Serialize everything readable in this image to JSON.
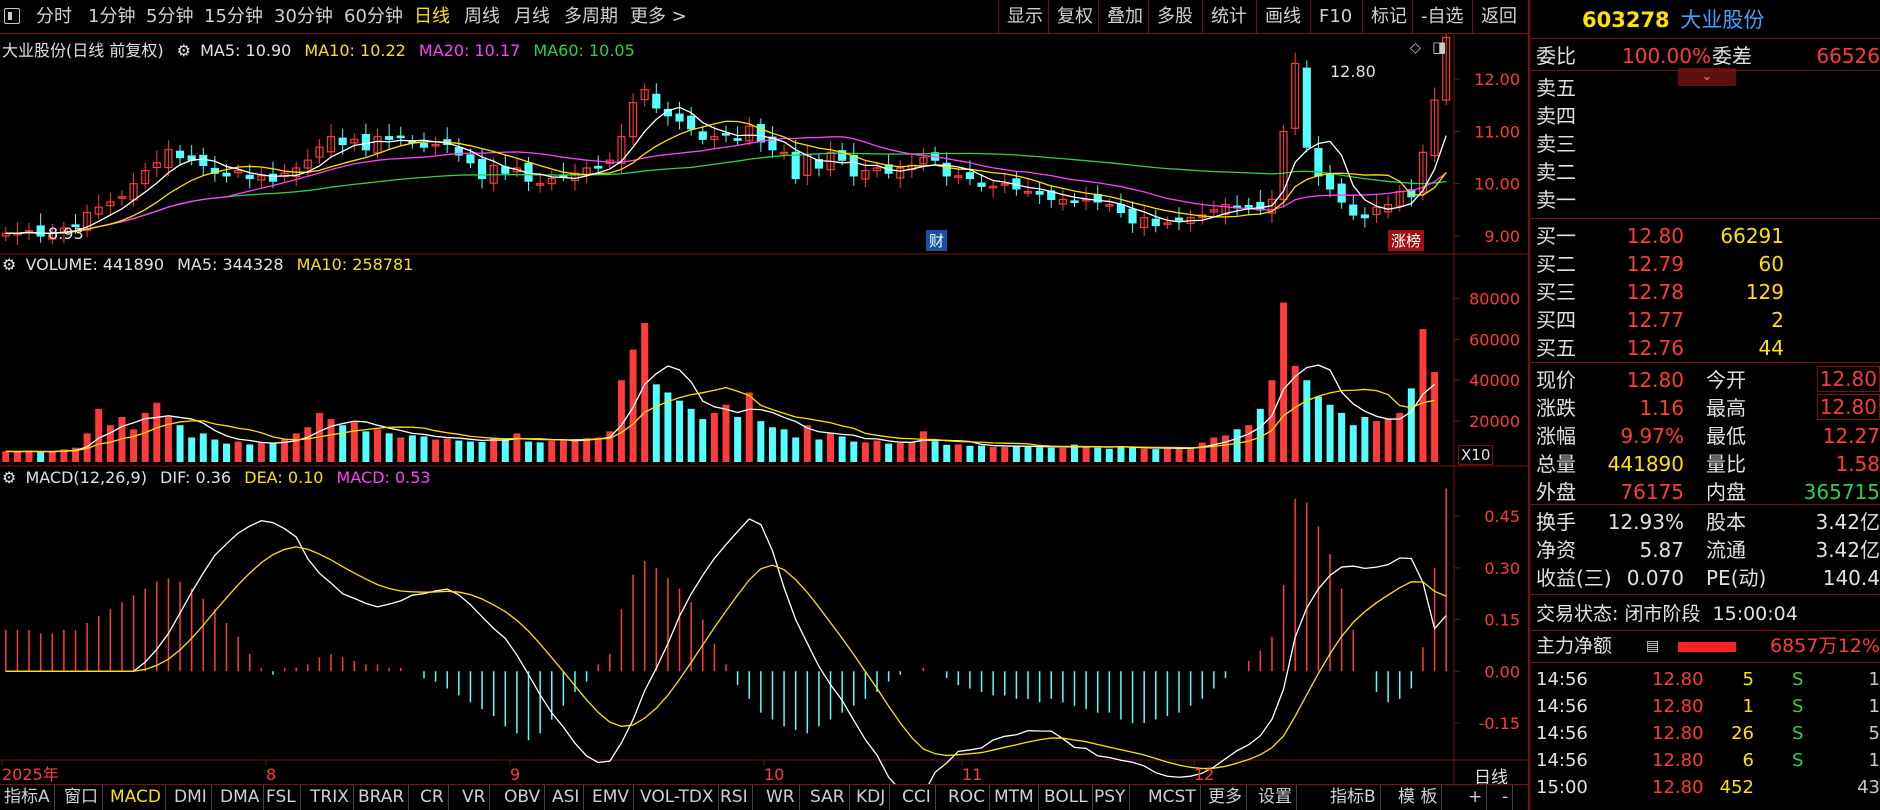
{
  "toolbar": {
    "left_tabs": [
      "分时",
      "1分钟",
      "5分钟",
      "15分钟",
      "30分钟",
      "60分钟",
      "日线",
      "周线",
      "月线",
      "多周期",
      "更多 >"
    ],
    "active_tab": "日线",
    "right_buttons": [
      "显示",
      "复权",
      "叠加",
      "多股",
      "统计",
      "画线",
      "F10",
      "标记",
      "-自选",
      "返回"
    ]
  },
  "main_chart": {
    "title": "大业股份(日线 前复权)",
    "ma5": "MA5: 10.90",
    "ma10": "MA10: 10.22",
    "ma20": "MA20: 10.17",
    "ma60": "MA60: 10.05",
    "high_label": "12.80",
    "low_label": "8.93",
    "badge_cai": "财",
    "badge_zhangbang": "涨榜",
    "yticks": [
      "12.00",
      "11.00",
      "10.00",
      "9.00"
    ]
  },
  "volume_chart": {
    "title": "VOLUME: 441890",
    "ma5": "MA5: 344328",
    "ma10": "MA10: 258781",
    "unit": "X10",
    "yticks": [
      "80000",
      "60000",
      "40000",
      "20000"
    ]
  },
  "macd_chart": {
    "title": "MACD(12,26,9)",
    "dif": "DIF: 0.36",
    "dea": "DEA: 0.10",
    "macd": "MACD: 0.53",
    "yticks": [
      "0.45",
      "0.30",
      "0.15",
      "0.00",
      "-0.15"
    ]
  },
  "xaxis": {
    "labels": [
      "2025年",
      "8",
      "9",
      "10",
      "11",
      "12"
    ],
    "period": "日线"
  },
  "bottom_tabs": [
    "指标A",
    "窗口",
    "MACD",
    "DMI",
    "DMA",
    "FSL",
    "TRIX",
    "BRAR",
    "CR",
    "VR",
    "OBV",
    "ASI",
    "EMV",
    "VOL-TDX",
    "RSI",
    "WR",
    "SAR",
    "KDJ",
    "CCI",
    "ROC",
    "MTM",
    "BOLL",
    "PSY",
    "MCST",
    "更多",
    "设置",
    "指标B",
    "模 板",
    "+",
    "-"
  ],
  "active_bottom_tab": "MACD",
  "stock": {
    "code": "603278",
    "name": "大业股份",
    "weibi_label": "委比",
    "weibi": "100.00%",
    "weicha_label": "委差",
    "weicha": "66526",
    "sell_labels": [
      "卖五",
      "卖四",
      "卖三",
      "卖二",
      "卖一"
    ],
    "buy": [
      {
        "label": "买一",
        "price": "12.80",
        "vol": "66291"
      },
      {
        "label": "买二",
        "price": "12.79",
        "vol": "60"
      },
      {
        "label": "买三",
        "price": "12.78",
        "vol": "129"
      },
      {
        "label": "买四",
        "price": "12.77",
        "vol": "2"
      },
      {
        "label": "买五",
        "price": "12.76",
        "vol": "44"
      }
    ],
    "stats": [
      {
        "l1": "现价",
        "v1": "12.80",
        "l2": "今开",
        "v2": "12.80"
      },
      {
        "l1": "涨跌",
        "v1": "1.16",
        "l2": "最高",
        "v2": "12.80"
      },
      {
        "l1": "涨幅",
        "v1": "9.97%",
        "l2": "最低",
        "v2": "12.27"
      },
      {
        "l1": "总量",
        "v1": "441890",
        "l2": "量比",
        "v2": "1.58"
      },
      {
        "l1": "外盘",
        "v1": "76175",
        "l2": "内盘",
        "v2": "365715"
      }
    ],
    "stats2": [
      {
        "l1": "换手",
        "v1": "12.93%",
        "l2": "股本",
        "v2": "3.42亿"
      },
      {
        "l1": "净资",
        "v1": "5.87",
        "l2": "流通",
        "v2": "3.42亿"
      },
      {
        "l1": "收益(三)",
        "v1": "0.070",
        "l2": "PE(动)",
        "v2": "140.4"
      }
    ],
    "trade_status_label": "交易状态:",
    "trade_status": "闭市阶段",
    "trade_time": "15:00:04",
    "main_flow_label": "主力净额",
    "main_flow_value": "6857万",
    "main_flow_pct": "12%",
    "ticks": [
      {
        "time": "14:56",
        "price": "12.80",
        "vol": "5",
        "side": "S",
        "n": "1"
      },
      {
        "time": "14:56",
        "price": "12.80",
        "vol": "1",
        "side": "S",
        "n": "1"
      },
      {
        "time": "14:56",
        "price": "12.80",
        "vol": "26",
        "side": "S",
        "n": "5"
      },
      {
        "time": "14:56",
        "price": "12.80",
        "vol": "6",
        "side": "S",
        "n": "1"
      },
      {
        "time": "15:00",
        "price": "12.80",
        "vol": "452",
        "side": "",
        "n": "43"
      }
    ]
  },
  "colors": {
    "up": "#ff3a3a",
    "down": "#54ffff",
    "ma5": "#ffffff",
    "ma10": "#ffe000",
    "ma20": "#ff40ff",
    "ma60": "#2ad24a",
    "border": "#7a1010"
  },
  "chart_data": {
    "type": "candlestick",
    "closes": [
      9.05,
      9.05,
      9.1,
      9.0,
      9.05,
      9.15,
      9.2,
      9.45,
      9.55,
      9.65,
      9.75,
      10.0,
      10.25,
      10.4,
      10.65,
      10.5,
      10.45,
      10.35,
      10.2,
      10.15,
      10.25,
      10.1,
      10.15,
      10.05,
      10.2,
      10.3,
      10.45,
      10.7,
      10.9,
      10.75,
      10.85,
      10.65,
      10.9,
      10.85,
      10.9,
      10.8,
      10.7,
      10.75,
      10.75,
      10.55,
      10.4,
      10.1,
      10.35,
      10.2,
      10.3,
      10.05,
      10.0,
      10.1,
      10.15,
      10.2,
      10.3,
      10.3,
      10.45,
      10.9,
      11.55,
      11.8,
      11.45,
      11.3,
      11.2,
      11.05,
      10.85,
      10.9,
      10.95,
      10.85,
      11.1,
      10.8,
      10.65,
      10.6,
      10.1,
      10.55,
      10.3,
      10.6,
      10.45,
      10.15,
      10.25,
      10.3,
      10.2,
      10.3,
      10.35,
      10.5,
      10.45,
      10.15,
      10.15,
      10.1,
      9.95,
      9.95,
      10.0,
      9.9,
      9.85,
      9.8,
      9.7,
      9.7,
      9.65,
      9.7,
      9.65,
      9.6,
      9.45,
      9.25,
      9.35,
      9.2,
      9.25,
      9.3,
      9.35,
      9.4,
      9.5,
      9.6,
      9.55,
      9.55,
      9.5,
      9.7,
      11.0,
      12.3,
      10.7,
      10.15,
      9.9,
      9.65,
      9.4,
      9.35,
      9.55,
      9.6,
      9.85,
      9.75,
      10.6,
      11.6,
      12.8
    ],
    "volume": [
      5200,
      5000,
      5400,
      4800,
      5100,
      6200,
      7000,
      14000,
      26000,
      18000,
      22000,
      16000,
      24000,
      29000,
      22000,
      18000,
      12000,
      14000,
      11000,
      9000,
      10000,
      8600,
      9400,
      9000,
      11000,
      14000,
      17000,
      24000,
      21000,
      18000,
      20000,
      15000,
      16000,
      14000,
      12000,
      13000,
      12500,
      11000,
      11500,
      10500,
      10000,
      9800,
      12000,
      11000,
      14000,
      10000,
      9600,
      10400,
      10800,
      11200,
      11600,
      12000,
      15000,
      40000,
      55000,
      68000,
      38000,
      34000,
      30000,
      26000,
      21000,
      24000,
      28000,
      22000,
      34000,
      20000,
      17000,
      16000,
      12000,
      18000,
      11000,
      14000,
      12500,
      10000,
      9600,
      10500,
      9000,
      9300,
      9800,
      15000,
      10200,
      8400,
      8600,
      7900,
      8000,
      7500,
      7300,
      8000,
      7800,
      7200,
      7000,
      6900,
      8500,
      7600,
      7000,
      6500,
      7800,
      7200,
      6500,
      6300,
      6600,
      6900,
      7200,
      9500,
      12000,
      13000,
      16000,
      18000,
      26000,
      40000,
      78000,
      47000,
      40000,
      32000,
      28000,
      24000,
      18000,
      22000,
      20000,
      21000,
      24000,
      36000,
      65000,
      44000
    ],
    "macd_hist": [
      0.12,
      0.12,
      0.12,
      0.11,
      0.11,
      0.12,
      0.12,
      0.14,
      0.16,
      0.18,
      0.2,
      0.22,
      0.24,
      0.26,
      0.27,
      0.26,
      0.24,
      0.21,
      0.18,
      0.14,
      0.1,
      0.05,
      0.01,
      -0.01,
      0.01,
      0.01,
      0.02,
      0.04,
      0.05,
      0.04,
      0.03,
      0.02,
      0.02,
      0.01,
      0.01,
      0.0,
      -0.02,
      -0.03,
      -0.05,
      -0.07,
      -0.09,
      -0.11,
      -0.13,
      -0.16,
      -0.18,
      -0.2,
      -0.18,
      -0.14,
      -0.1,
      -0.06,
      -0.03,
      0.02,
      0.05,
      0.18,
      0.28,
      0.32,
      0.3,
      0.27,
      0.24,
      0.2,
      0.15,
      0.08,
      0.02,
      -0.04,
      -0.08,
      -0.12,
      -0.14,
      -0.16,
      -0.17,
      -0.18,
      -0.16,
      -0.14,
      -0.12,
      -0.1,
      -0.08,
      -0.06,
      -0.03,
      -0.01,
      0.0,
      0.01,
      0.0,
      -0.02,
      -0.04,
      -0.05,
      -0.06,
      -0.07,
      -0.07,
      -0.08,
      -0.08,
      -0.09,
      -0.08,
      -0.09,
      -0.1,
      -0.11,
      -0.12,
      -0.12,
      -0.14,
      -0.15,
      -0.15,
      -0.14,
      -0.13,
      -0.12,
      -0.1,
      -0.08,
      -0.05,
      -0.02,
      0.0,
      0.03,
      0.06,
      0.1,
      0.25,
      0.5,
      0.49,
      0.42,
      0.34,
      0.24,
      0.12,
      0.0,
      -0.06,
      -0.09,
      -0.08,
      -0.05,
      0.07,
      0.3,
      0.53
    ],
    "yticks_price": [
      9.0,
      10.0,
      11.0,
      12.0
    ],
    "price_range": [
      8.75,
      12.75
    ],
    "volume_range": [
      0,
      90000
    ],
    "macd_range": [
      -0.24,
      0.52
    ]
  }
}
